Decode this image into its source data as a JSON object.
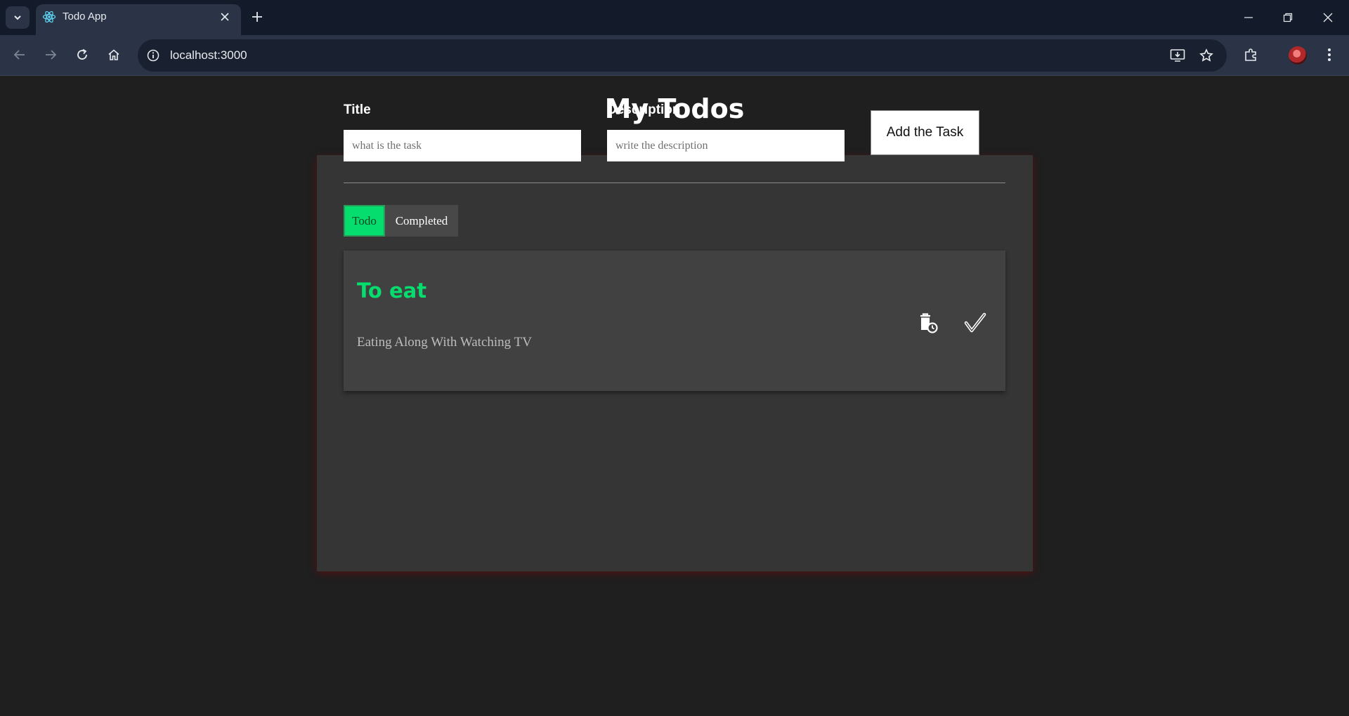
{
  "browser": {
    "tab_title": "Todo App",
    "url": "localhost:3000"
  },
  "app": {
    "page_title": "My Todos",
    "form": {
      "title_label": "Title",
      "title_placeholder": "what is the task",
      "title_value": "",
      "description_label": "Description",
      "description_placeholder": "write the description",
      "description_value": "",
      "add_button_label": "Add the Task"
    },
    "filters": [
      {
        "label": "Todo",
        "active": true
      },
      {
        "label": "Completed",
        "active": false
      }
    ],
    "todos": [
      {
        "title": "To eat",
        "description": "Eating Along With Watching TV",
        "actions": [
          "delete-icon",
          "check-icon"
        ]
      }
    ]
  },
  "colors": {
    "accent_green": "#05de6e",
    "page_background": "#1f1f1f",
    "card_background": "#353535",
    "item_background": "#414141"
  }
}
